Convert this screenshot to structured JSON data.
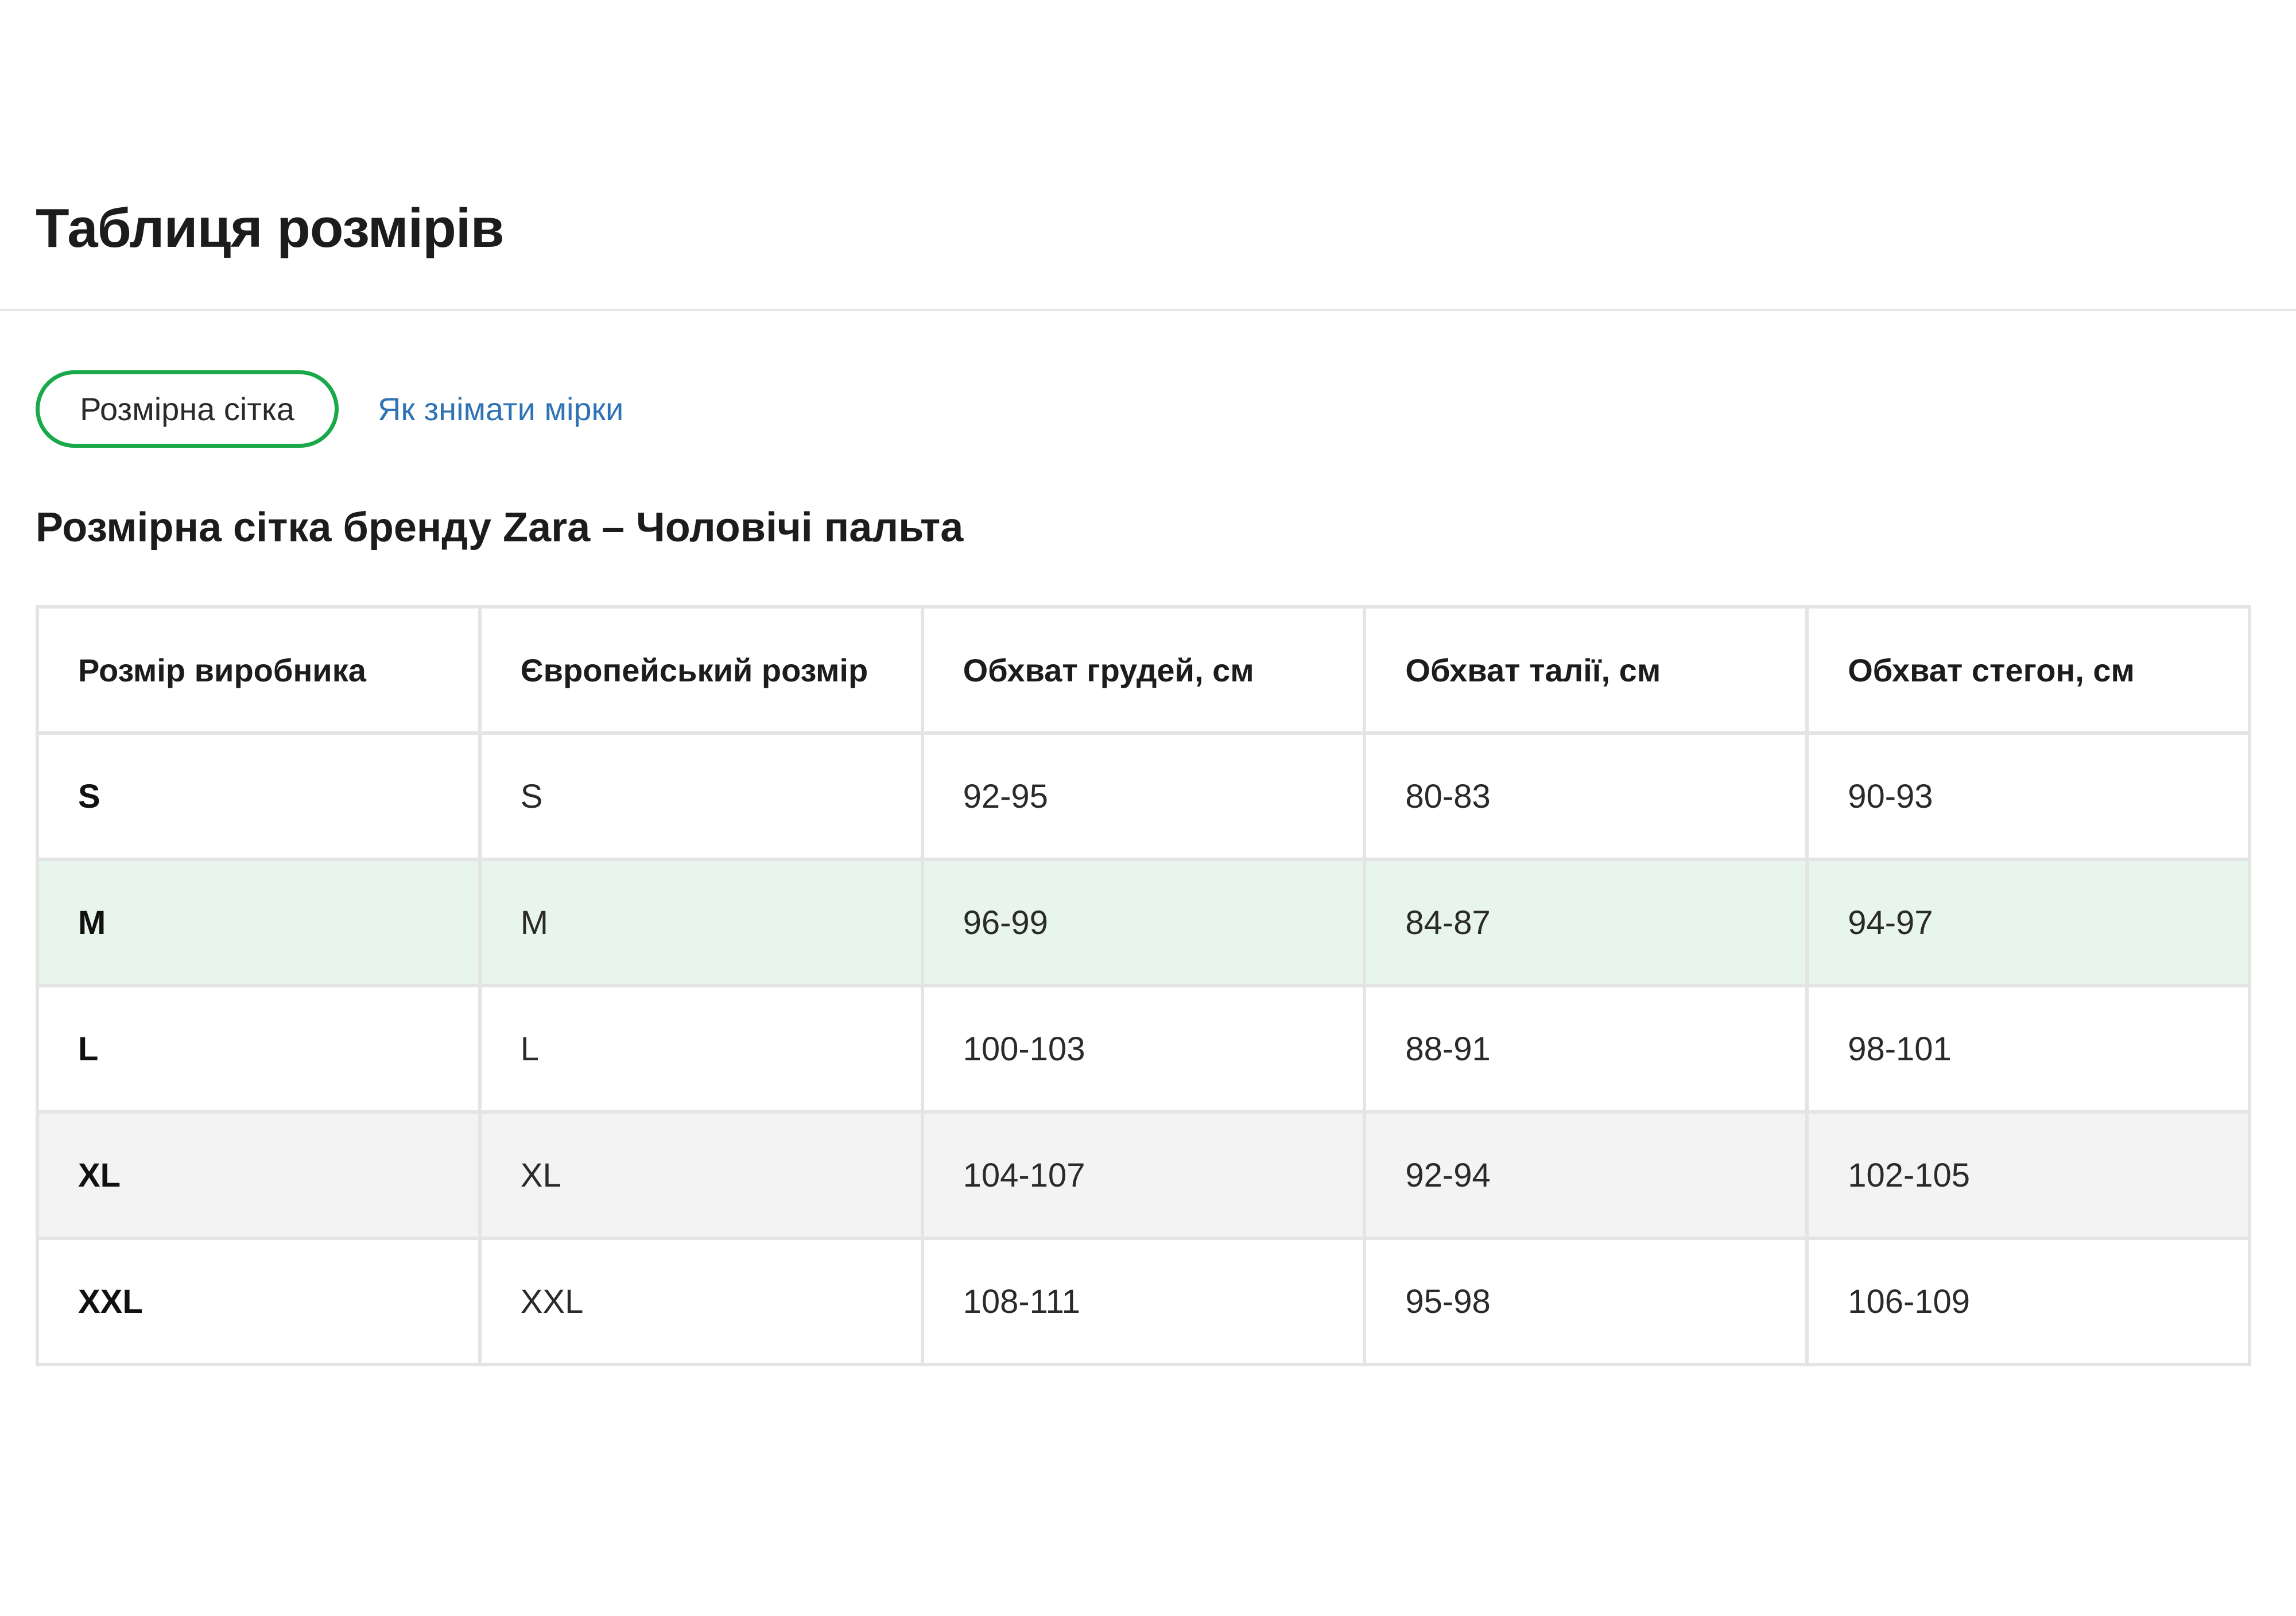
{
  "page": {
    "title": "Таблиця розмірів"
  },
  "tabs": {
    "active_label": "Розмірна сітка",
    "link_label": "Як знімати мірки"
  },
  "section": {
    "title": "Розмірна сітка бренду Zara – Чоловічі пальта"
  },
  "colors": {
    "accent_green": "#1aa94a",
    "link_blue": "#2f73b5",
    "highlight_row": "#e8f5ec",
    "shaded_row": "#f3f3f3"
  },
  "table": {
    "headers": [
      "Розмір виробника",
      "Європейський розмір",
      "Обхват грудей, см",
      "Обхват талії, см",
      "Обхват стегон, см"
    ],
    "rows": [
      [
        "S",
        "S",
        "92-95",
        "80-83",
        "90-93"
      ],
      [
        "M",
        "M",
        "96-99",
        "84-87",
        "94-97"
      ],
      [
        "L",
        "L",
        "100-103",
        "88-91",
        "98-101"
      ],
      [
        "XL",
        "XL",
        "104-107",
        "92-94",
        "102-105"
      ],
      [
        "XXL",
        "XXL",
        "108-111",
        "95-98",
        "106-109"
      ]
    ]
  }
}
